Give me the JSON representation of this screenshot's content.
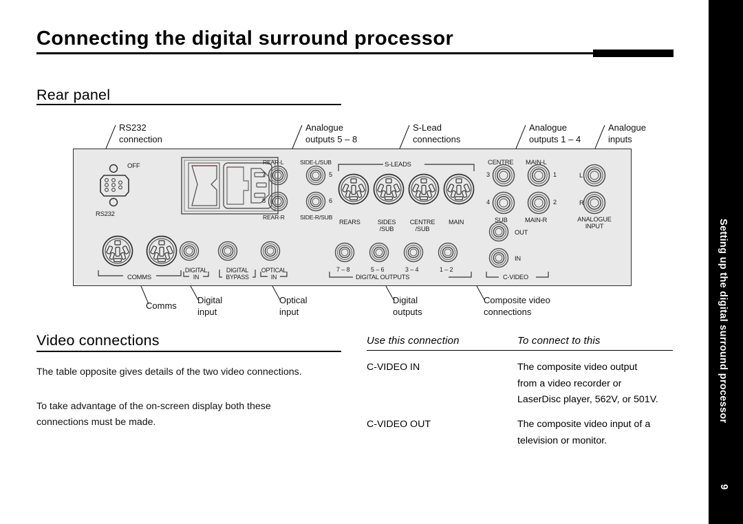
{
  "title": "Connecting the digital surround processor",
  "side_tab": {
    "text": "Setting up the digital surround processor",
    "page": "9"
  },
  "sections": {
    "rear_panel_heading": "Rear panel",
    "video_connections_heading": "Video connections"
  },
  "body": {
    "para1": "The table opposite gives details of the two video connections.",
    "para2": "To take advantage of the on-screen display both these connections must be made."
  },
  "table": {
    "header_left": "Use this connection",
    "header_right": "To connect to this",
    "rows": [
      {
        "connection": "C-VIDEO IN",
        "description": "The composite video output from a video recorder or LaserDisc player, 562V, or 501V.",
        "lines": [
          "The composite video output",
          "from a video recorder or",
          "LaserDisc player, 562V, or 501V."
        ]
      },
      {
        "connection": "C-VIDEO OUT",
        "description": "The composite video input of a television or monitor.",
        "lines": [
          "The composite video input of a",
          "television or monitor."
        ]
      }
    ]
  },
  "callouts_top": [
    {
      "name": "rs232-connection",
      "lines": [
        "RS232",
        "connection"
      ]
    },
    {
      "name": "analogue-outputs-5-8",
      "lines": [
        "Analogue",
        "outputs 5 – 8"
      ]
    },
    {
      "name": "s-lead-connections",
      "lines": [
        "S-Lead",
        "connections"
      ]
    },
    {
      "name": "analogue-outputs-1-4",
      "lines": [
        "Analogue",
        "outputs 1 – 4"
      ]
    },
    {
      "name": "analogue-inputs",
      "lines": [
        "Analogue",
        "inputs"
      ]
    }
  ],
  "callouts_bottom": [
    {
      "name": "comms",
      "lines": [
        "Comms"
      ]
    },
    {
      "name": "digital-input",
      "lines": [
        "Digital",
        "input"
      ]
    },
    {
      "name": "optical-input",
      "lines": [
        "Optical",
        "input"
      ]
    },
    {
      "name": "digital-outputs",
      "lines": [
        "Digital",
        "outputs"
      ]
    },
    {
      "name": "composite-video-connections",
      "lines": [
        "Composite video",
        "connections"
      ]
    }
  ],
  "panel_labels": {
    "off": "OFF",
    "rs232": "RS232",
    "comms": "COMMS",
    "digital_in": [
      "DIGITAL",
      "IN"
    ],
    "digital_bypass": [
      "DIGITAL",
      "BYPASS"
    ],
    "optical_in": [
      "OPTICAL",
      "IN"
    ],
    "rear_l": "REAR-L",
    "side_l_sub": "SIDE-L/SUB",
    "rear_r": "REAR-R",
    "side_r_sub": "SIDE-R/SUB",
    "num7": "7",
    "num8": "8",
    "num5": "5",
    "num6": "6",
    "s_leads": "S-LEADS",
    "rears": "REARS",
    "sides_sub": [
      "SIDES",
      "/SUB"
    ],
    "centre_sub": [
      "CENTRE",
      "/SUB"
    ],
    "main": "MAIN",
    "digital_outputs": "DIGITAL OUTPUTS",
    "do_7_8": "7 – 8",
    "do_5_6": "5 – 6",
    "do_3_4": "3 – 4",
    "do_1_2": "1 – 2",
    "centre": "CENTRE",
    "main_l": "MAIN-L",
    "sub": "SUB",
    "main_r": "MAIN-R",
    "num3": "3",
    "num4": "4",
    "num1": "1",
    "num2": "2",
    "out": "OUT",
    "in": "IN",
    "c_video": "C-VIDEO",
    "analogue_input": [
      "ANALOGUE",
      "INPUT"
    ],
    "lab_l": "L",
    "lab_r": "R"
  },
  "colors": {
    "panel_bg": "#e9e9e9",
    "panel_border": "#2b2b2b",
    "ink": "#000000",
    "tab_bg": "#000000",
    "tab_fg": "#ffffff"
  }
}
